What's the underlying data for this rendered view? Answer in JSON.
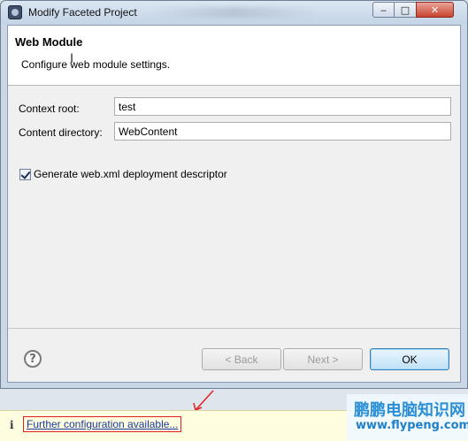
{
  "window": {
    "title": "Modify Faceted Project",
    "min_symbol": "‒",
    "max_symbol": "□",
    "close_symbol": "✕"
  },
  "banner": {
    "title": "Web Module",
    "description": "Configure web module settings."
  },
  "form": {
    "context_root_label": "Context root:",
    "context_root_value": "test",
    "content_dir_label": "Content directory:",
    "content_dir_value": "WebContent",
    "generate_label": "Generate web.xml deployment descriptor",
    "generate_checked": true
  },
  "buttons": {
    "help_symbol": "?",
    "back": "< Back",
    "next": "Next >",
    "ok": "OK"
  },
  "status": {
    "info_symbol": "i",
    "link": "Further configuration available..."
  },
  "watermark": {
    "name": "鹏鹏电脑知识网",
    "url": "www.flypeng.com"
  },
  "colors": {
    "link": "#1a3a9a",
    "annotation": "#e02020",
    "watermark": "#2b8fd6"
  }
}
